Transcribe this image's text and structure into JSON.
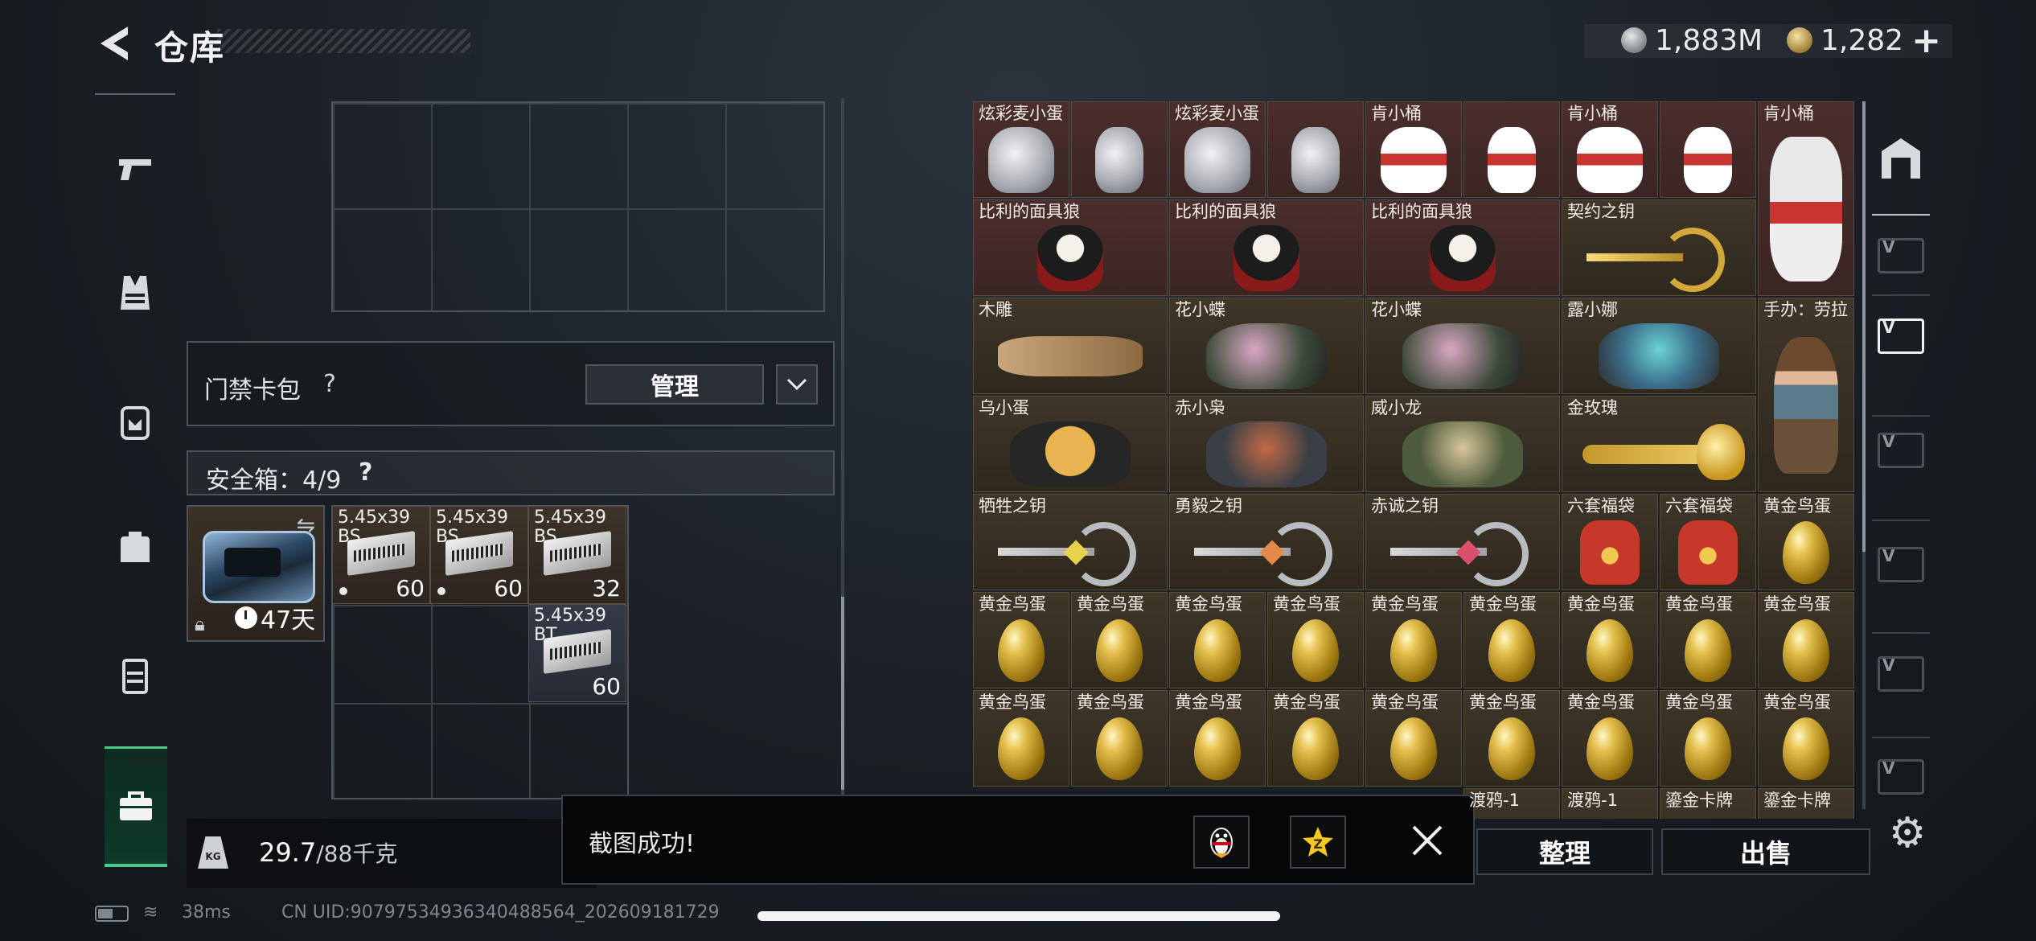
{
  "header": {
    "title": "仓库",
    "currency_silver": "1,883M",
    "currency_gold": "1,282",
    "add_label": "+"
  },
  "left_nav": {
    "items": [
      "pistol-icon",
      "vest-icon",
      "backpack-armor-icon",
      "backpack-icon",
      "chest-rig-icon",
      "briefcase-icon"
    ],
    "active": "briefcase-icon"
  },
  "card_pack": {
    "label": "门禁卡包",
    "help": "?",
    "manage_label": "管理"
  },
  "safe_box": {
    "label": "安全箱：4/9",
    "help": "?",
    "expires": "47天",
    "items": [
      {
        "name": "5.45x39 BS",
        "count": "60"
      },
      {
        "name": "5.45x39 BS",
        "count": "60"
      },
      {
        "name": "5.45x39 BS",
        "count": "32"
      },
      {
        "name": "5.45x39 BT",
        "count": "60"
      }
    ]
  },
  "weight": {
    "current": "29.7",
    "max": "/88千克",
    "badge": "KG"
  },
  "stash": {
    "items": [
      {
        "name": "炫彩麦小蛋"
      },
      {
        "name": "炫彩麦小蛋"
      },
      {
        "name": "肯小桶"
      },
      {
        "name": "肯小桶"
      },
      {
        "name": "肯小桶"
      },
      {
        "name": "比利的面具狼"
      },
      {
        "name": "比利的面具狼"
      },
      {
        "name": "比利的面具狼"
      },
      {
        "name": "契约之钥"
      },
      {
        "name": "木雕"
      },
      {
        "name": "花小蝶"
      },
      {
        "name": "花小蝶"
      },
      {
        "name": "露小娜"
      },
      {
        "name": "手办：劳拉"
      },
      {
        "name": "乌小蛋"
      },
      {
        "name": "赤小枭"
      },
      {
        "name": "威小龙"
      },
      {
        "name": "金玫瑰"
      },
      {
        "name": "牺牲之钥"
      },
      {
        "name": "勇毅之钥"
      },
      {
        "name": "赤诚之钥"
      },
      {
        "name": "六套福袋"
      },
      {
        "name": "六套福袋"
      },
      {
        "name": "黄金鸟蛋"
      },
      {
        "name": "黄金鸟蛋"
      },
      {
        "name": "渡鸦-1"
      },
      {
        "name": "渡鸦-1"
      },
      {
        "name": "鎏金卡牌"
      },
      {
        "name": "鎏金卡牌"
      }
    ]
  },
  "actions": {
    "sort_label": "整理",
    "sell_label": "出售"
  },
  "toast": {
    "message": "截图成功!"
  },
  "status": {
    "ping": "38ms",
    "uid": "CN UID:9079753493634048856‌4_202609181729"
  },
  "colors": {
    "accent_green": "#49c98b",
    "stash_cell": "#4a2e2c",
    "gold_cell": "#3f3628"
  }
}
